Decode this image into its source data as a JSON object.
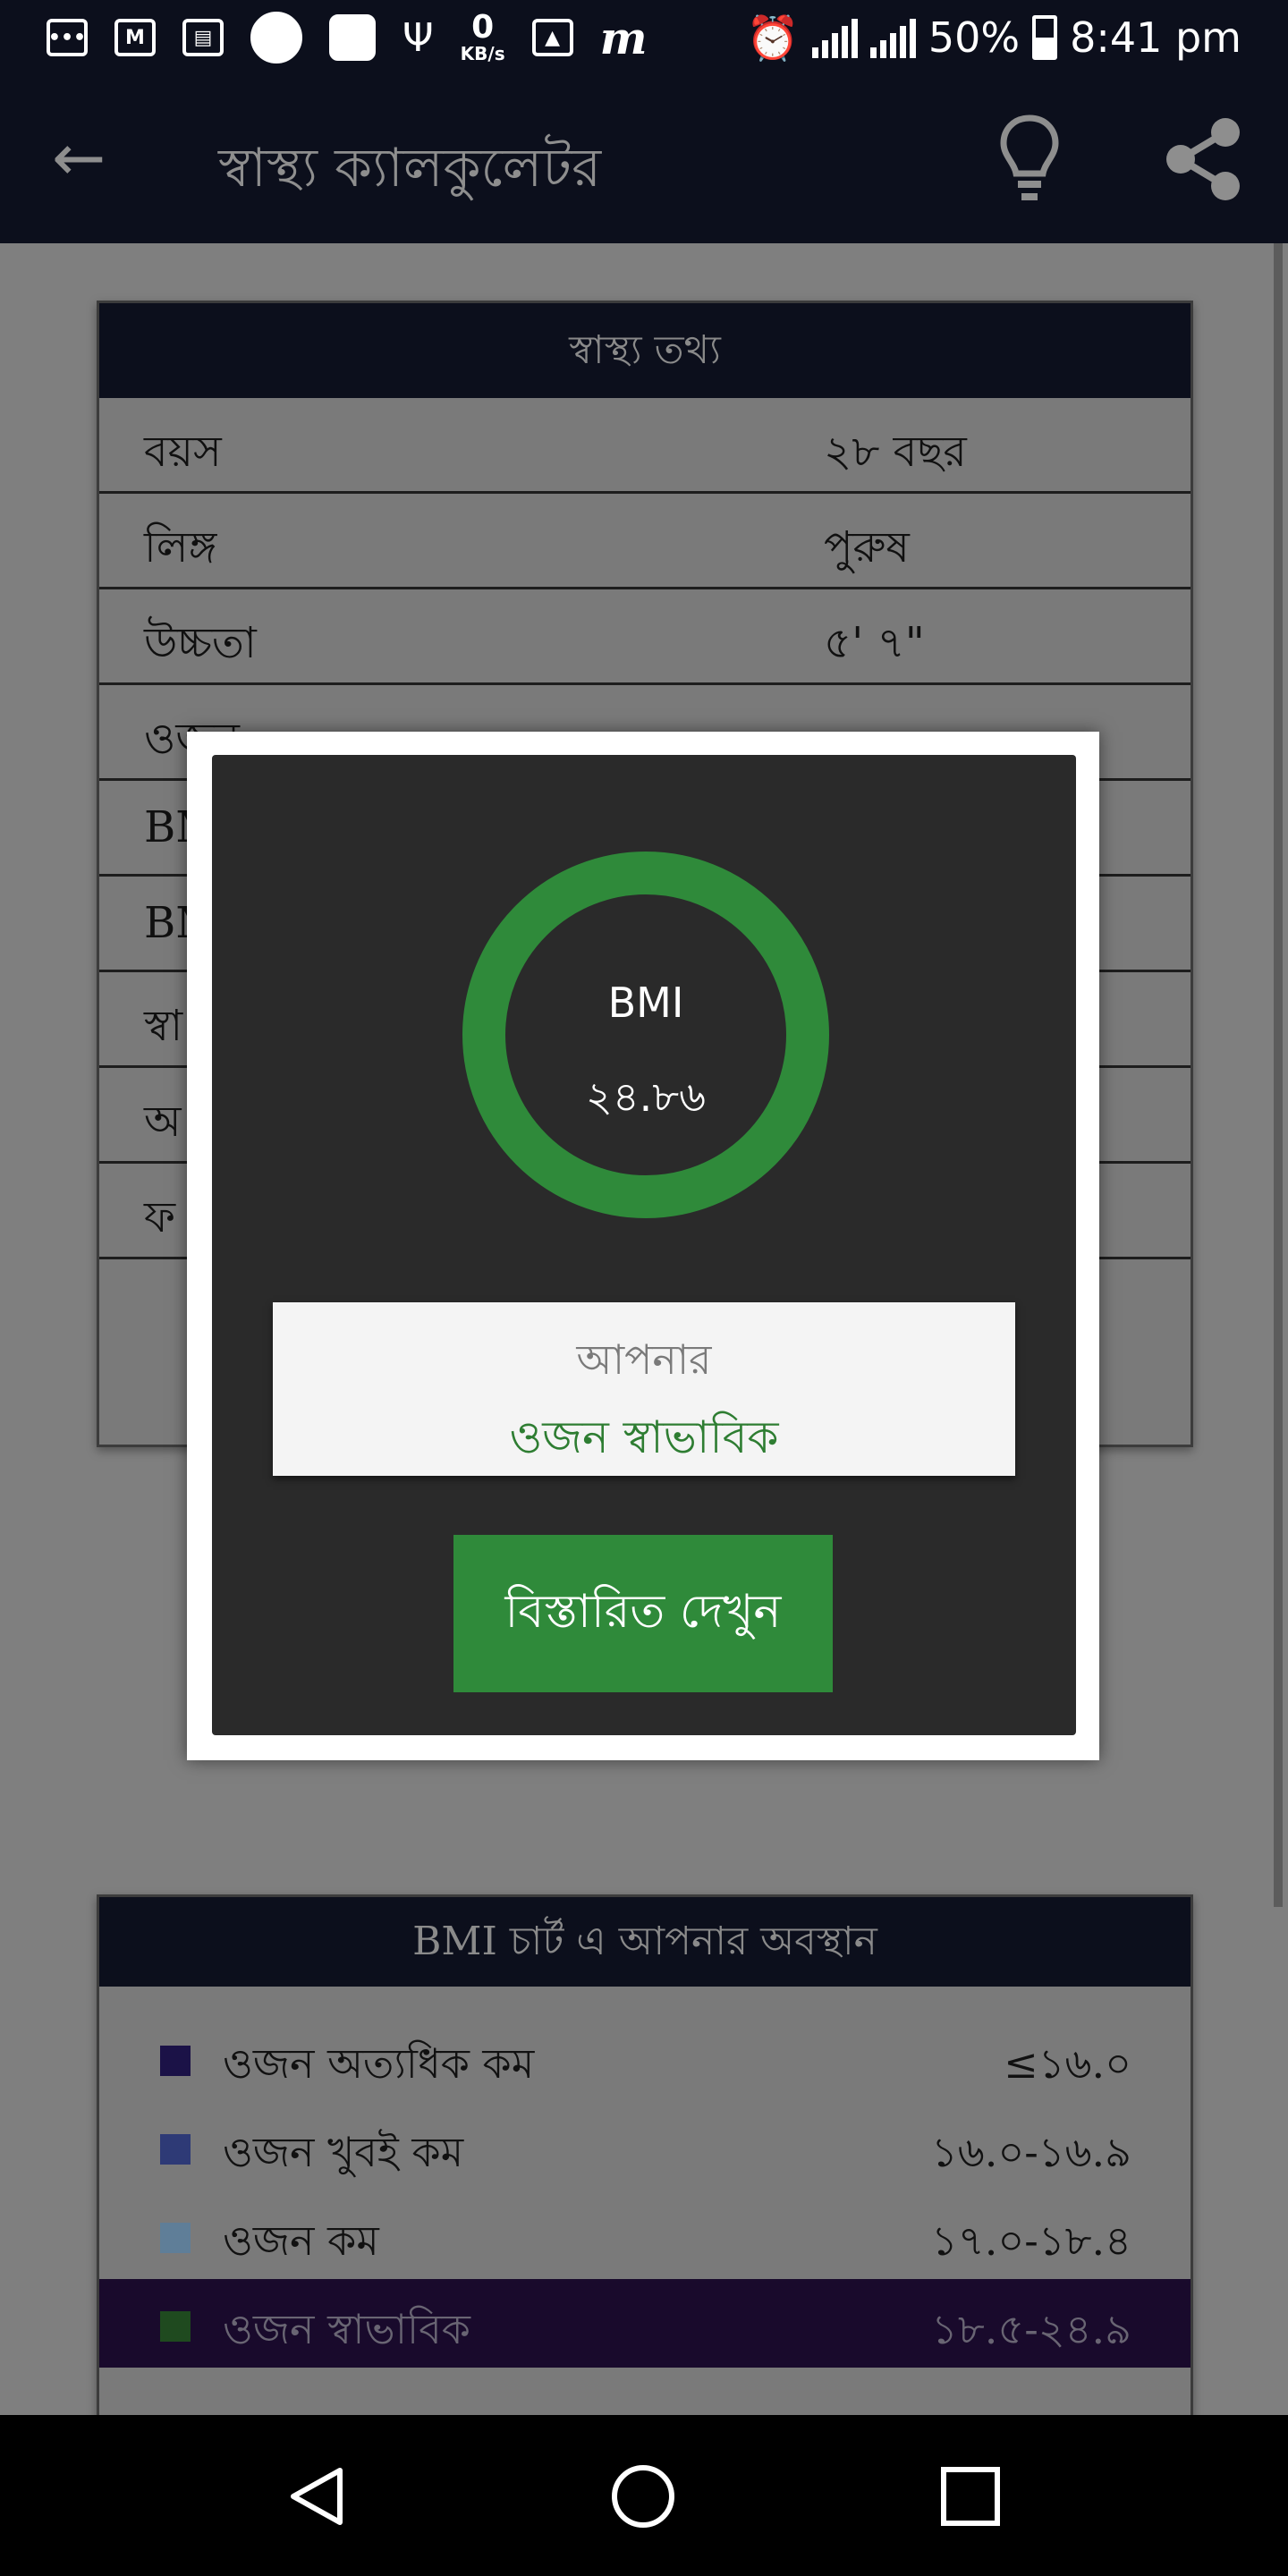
{
  "status_bar": {
    "net_speed_value": "0",
    "net_speed_unit": "KB/s",
    "battery_percent": "50%",
    "time": "8:41 pm",
    "icons": [
      "message-icon",
      "gmail-icon",
      "news-icon",
      "circle-icon",
      "square-icon",
      "usb-icon",
      "image-icon",
      "m-app-icon",
      "alarm-icon",
      "signal-3g-icon",
      "signal-3g-icon",
      "battery-icon"
    ]
  },
  "app_bar": {
    "title": "স্বাস্থ্য ক্যালকুলেটর",
    "back_icon": "arrow-back-icon",
    "tip_icon": "lightbulb-icon",
    "share_icon": "share-icon"
  },
  "health_info": {
    "title": "স্বাস্থ্য তথ্য",
    "rows": [
      {
        "label": "বয়স",
        "value": "২৮ বছর"
      },
      {
        "label": "লিঙ্গ",
        "value": "পুরুষ"
      },
      {
        "label": "উচ্চতা",
        "value": "৫' ৭\""
      },
      {
        "label": "ওজন",
        "value": ""
      },
      {
        "label": "BM",
        "value": ""
      },
      {
        "label": "BM",
        "value": ""
      },
      {
        "label": "স্বা",
        "value": ""
      },
      {
        "label": "অ",
        "value": ""
      },
      {
        "label": "ফ",
        "value": ""
      }
    ]
  },
  "dialog": {
    "ring_label": "BMI",
    "ring_value": "২৪.৮৬",
    "result_line1": "আপনার",
    "result_line2": "ওজন স্বাভাবিক",
    "details_button": "বিস্তারিত দেখুন",
    "ring_color": "#2f8a3a"
  },
  "bmi_chart": {
    "title": "BMI চার্ট এ আপনার অবস্থান",
    "rows": [
      {
        "label": "ওজন অত্যধিক কম",
        "range": "≤১৬.০",
        "color": "#1b1247"
      },
      {
        "label": "ওজন খুবই কম",
        "range": "১৬.০-১৬.৯",
        "color": "#2e3a76"
      },
      {
        "label": "ওজন কম",
        "range": "১৭.০-১৮.৪",
        "color": "#5f7e98"
      },
      {
        "label": "ওজন স্বাভাবিক",
        "range": "১৮.৫-২৪.৯",
        "color": "#1f4a1f",
        "active": true
      }
    ]
  },
  "nav_bar": {
    "icons": [
      "nav-back-icon",
      "nav-home-icon",
      "nav-recents-icon"
    ]
  }
}
